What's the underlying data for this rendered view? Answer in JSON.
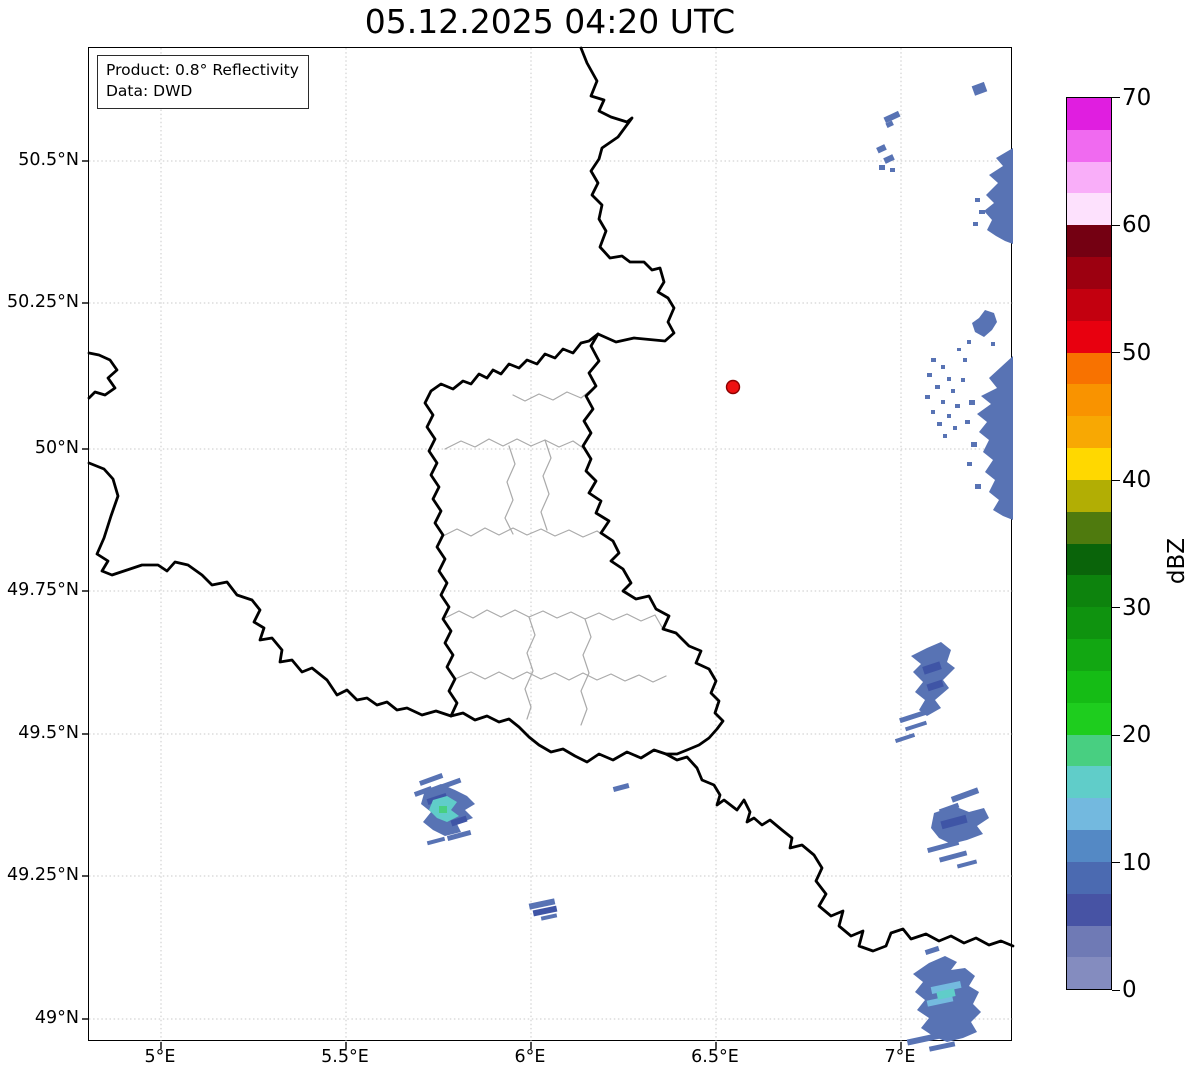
{
  "title": "05.12.2025 04:20 UTC",
  "info_box": {
    "product_line": "Product: 0.8° Reflectivity",
    "data_line": "Data: DWD"
  },
  "axes": {
    "x_tick_labels": [
      "5°E",
      "5.5°E",
      "6°E",
      "6.5°E",
      "7°E"
    ],
    "y_tick_labels": [
      "50.5°N",
      "50.25°N",
      "50°N",
      "49.75°N",
      "49.5°N",
      "49.25°N",
      "49°N"
    ]
  },
  "colorbar": {
    "label": "dBZ",
    "tick_labels_top_to_bottom": [
      "70",
      "60",
      "50",
      "40",
      "30",
      "20",
      "10",
      "0"
    ],
    "band_colors_low_to_high": [
      "#848cbf",
      "#6f7ab5",
      "#4753a4",
      "#4b6ab1",
      "#5489c5",
      "#73b9df",
      "#60cdc9",
      "#48cf81",
      "#1ecd1e",
      "#15bc15",
      "#12a712",
      "#0f930f",
      "#0d830d",
      "#0a640a",
      "#4f7a0e",
      "#b2ae04",
      "#ffd800",
      "#f8a803",
      "#f99300",
      "#f87200",
      "#e8000f",
      "#c3000f",
      "#9c0010",
      "#740012",
      "#fde1fd",
      "#f9aef9",
      "#f06af0",
      "#e01ee0"
    ]
  },
  "map": {
    "marker_color": "#ee1111",
    "marker_edge_color": "#8b0000",
    "echo_colors": {
      "blue": "#5873b4",
      "dark_blue": "#3f55a6",
      "light_blue": "#74badf",
      "cyan": "#60cdc9",
      "green": "#48cf81"
    },
    "border_colors": {
      "country": "#000000",
      "district": "#aaaaaa"
    },
    "grid_color": "#c9c9c9"
  }
}
